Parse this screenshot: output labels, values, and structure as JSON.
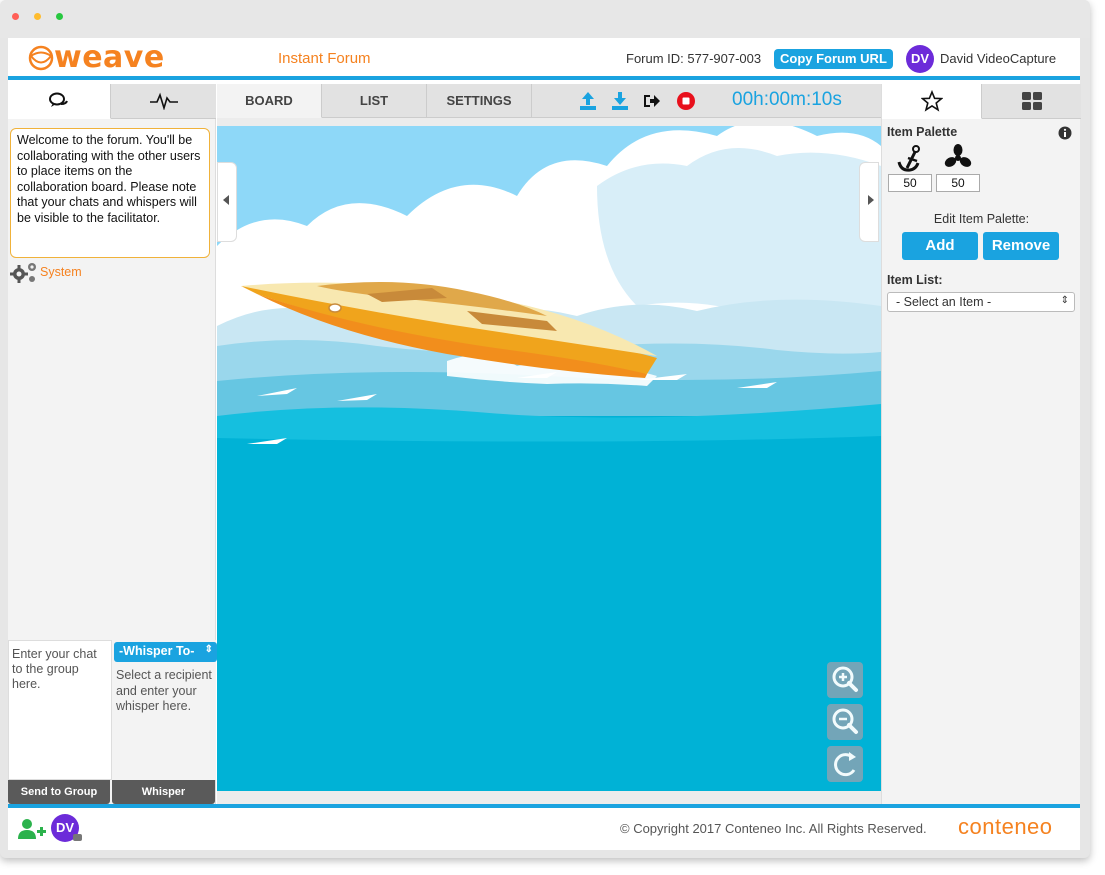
{
  "window": {
    "dot_colors": [
      "#ff5f57",
      "#febc2e",
      "#28c840"
    ]
  },
  "header": {
    "logo_text": "weave",
    "forum_title": "Instant Forum",
    "forum_id": "Forum ID: 577-907-003",
    "copy_url_label": "Copy Forum URL",
    "user_initials": "DV",
    "user_name": "David VideoCapture"
  },
  "left_panel": {
    "tabs": [
      {
        "icon": "chat-bubbles-icon"
      },
      {
        "icon": "activity-pulse-icon"
      }
    ],
    "welcome_message": "Welcome to the forum. You'll be collaborating with the other users to place items on the collaboration board. Please note that your chats and whispers will be visible to the facilitator.",
    "system_label": "System",
    "chat_placeholder": "Enter your chat to the group here.",
    "whisper_select": "-Whisper To-",
    "whisper_placeholder": "Select a recipient and enter your whisper here.",
    "send_group_label": "Send to Group",
    "whisper_label": "Whisper"
  },
  "center": {
    "tabs": [
      "BOARD",
      "LIST",
      "SETTINGS"
    ],
    "active_tab": "BOARD",
    "toolbar_icons": [
      "upload-icon",
      "download-icon",
      "exit-icon",
      "stop-record-icon"
    ],
    "timer": "00h:00m:10s",
    "zoom_controls": [
      "zoom-in-icon",
      "zoom-out-icon",
      "reset-icon"
    ]
  },
  "right_panel": {
    "tabs": [
      {
        "icon": "star-icon"
      },
      {
        "icon": "grid-icon"
      }
    ],
    "palette_title": "Item Palette",
    "palette_items": [
      {
        "icon": "anchor-icon",
        "count": "50"
      },
      {
        "icon": "propeller-icon",
        "count": "50"
      }
    ],
    "edit_palette_label": "Edit Item Palette:",
    "add_label": "Add",
    "remove_label": "Remove",
    "item_list_label": "Item List:",
    "item_select": "- Select an Item -"
  },
  "footer": {
    "copyright": "© Copyright 2017 Conteneo Inc. All Rights Reserved.",
    "brand": "conteneo",
    "user_initials": "DV"
  },
  "colors": {
    "accent_blue": "#1aa3e0",
    "brand_orange": "#f58220",
    "avatar_purple": "#6c2bd9",
    "record_red": "#e8101c",
    "sky": "#8ed8f8",
    "sea": "#00b2d6"
  }
}
